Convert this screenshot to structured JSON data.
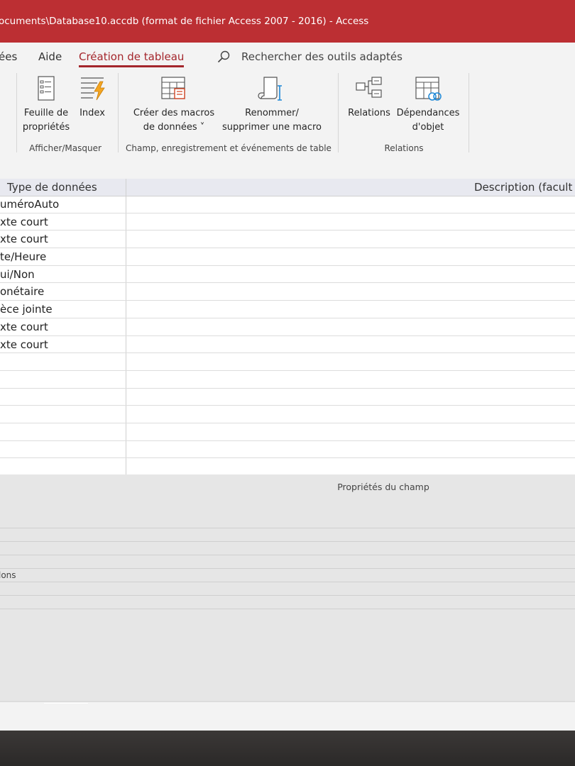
{
  "window": {
    "title": "ocuments\\Database10.accdb (format de fichier Access 2007 - 2016)  -  Access"
  },
  "tabs": [
    {
      "label": "ées"
    },
    {
      "label": "Aide"
    },
    {
      "label": "Création de tableau",
      "active": true
    }
  ],
  "search": {
    "text": "Rechercher des outils adaptés"
  },
  "ribbon": {
    "buttons": {
      "property_sheet": [
        "Feuille de",
        "propriétés"
      ],
      "index": [
        "Index"
      ],
      "data_macros": [
        "Créer des macros",
        "de données ˅"
      ],
      "rename_macro": [
        "Renommer/",
        "supprimer une macro"
      ],
      "relations": [
        "Relations"
      ],
      "dependencies": [
        "Dépendances",
        "d'objet"
      ]
    },
    "groups": {
      "show_hide": "Afficher/Masquer",
      "field_events": "Champ, enregistrement et événements de table",
      "relations": "Relations"
    }
  },
  "grid": {
    "headers": {
      "type": "Type de données",
      "description": "Description (facult"
    },
    "rows": [
      "uméroAuto",
      "xte court",
      "xte court",
      "te/Heure",
      "ui/Non",
      "onétaire",
      "èce jointe",
      "xte court",
      "xte court",
      "",
      "",
      "",
      "",
      "",
      "",
      "",
      ""
    ]
  },
  "properties": {
    "title": "Propriétés du champ",
    "rows": [
      "",
      "",
      "",
      "",
      "lons",
      "",
      ""
    ]
  },
  "colors": {
    "title_bar": "#bc2f33",
    "accent": "#a4262c",
    "ribbon_bg": "#f3f3f3",
    "grid_header": "#e8e9f0"
  }
}
